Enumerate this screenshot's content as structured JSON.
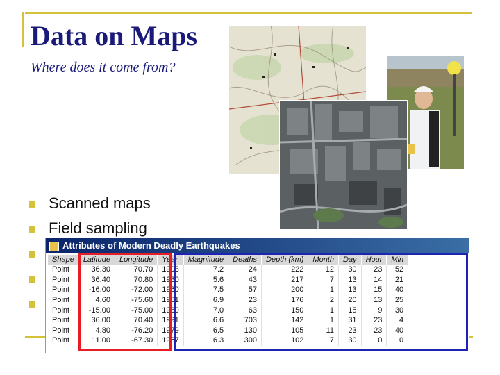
{
  "slide": {
    "title": "Data on Maps",
    "subtitle": "Where does it come from?",
    "bullets": [
      "Scanned maps",
      "Field sampling",
      "",
      "",
      ""
    ]
  },
  "images": {
    "topo": "scanned-topographic-map",
    "aerial": "aerial-city-photo",
    "field": "field-gps-surveyor-photo"
  },
  "table": {
    "title": "Attributes of Modern Deadly Earthquakes",
    "columns": [
      "Shape",
      "Latitude",
      "Longitude",
      "Year",
      "Magnitude",
      "Deaths",
      "Depth (km)",
      "Month",
      "Day",
      "Hour",
      "Min"
    ],
    "rows": [
      [
        "Point",
        "36.30",
        "70.70",
        "1903",
        "7.2",
        "24",
        "222",
        "12",
        "30",
        "23",
        "52"
      ],
      [
        "Point",
        "36.40",
        "70.80",
        "1980",
        "5.6",
        "43",
        "217",
        "7",
        "13",
        "14",
        "21"
      ],
      [
        "Point",
        "-16.00",
        "-72.00",
        "1960",
        "7.5",
        "57",
        "200",
        "1",
        "13",
        "15",
        "40"
      ],
      [
        "Point",
        "4.60",
        "-75.60",
        "1961",
        "6.9",
        "23",
        "176",
        "2",
        "20",
        "13",
        "25"
      ],
      [
        "Point",
        "-15.00",
        "-75.00",
        "1980",
        "7.0",
        "63",
        "150",
        "1",
        "15",
        "9",
        "30"
      ],
      [
        "Point",
        "36.00",
        "70.40",
        "1991",
        "6.6",
        "703",
        "142",
        "1",
        "31",
        "23",
        "4"
      ],
      [
        "Point",
        "4.80",
        "-76.20",
        "1979",
        "6.5",
        "130",
        "105",
        "11",
        "23",
        "23",
        "40"
      ],
      [
        "Point",
        "11.00",
        "-67.30",
        "1967",
        "6.3",
        "300",
        "102",
        "7",
        "30",
        "0",
        "0"
      ]
    ]
  },
  "colors": {
    "accent": "#d4c23a",
    "title": "#1a1a7a",
    "highlight_coords": "#e81c24",
    "highlight_attributes": "#1c24b4"
  }
}
